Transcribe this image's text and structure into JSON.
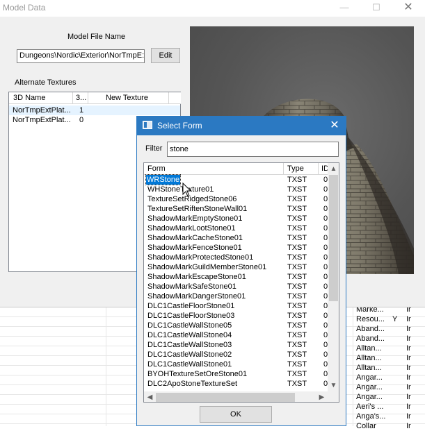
{
  "model_window": {
    "title": "Model Data",
    "model_file_label": "Model File Name",
    "model_file_value": "Dungeons\\Nordic\\Exterior\\NorTmpE:",
    "edit_label": "Edit",
    "alt_textures_label": "Alternate Textures",
    "table": {
      "headers": [
        "3D Name",
        "3...",
        "New Texture"
      ],
      "rows": [
        {
          "name": "NorTmpExtPlat...",
          "idx": "1"
        },
        {
          "name": "NorTmpExtPlat...",
          "idx": "0"
        }
      ]
    }
  },
  "background_list": {
    "rows": [
      {
        "a": "Marke...",
        "b": "",
        "c": "Ir"
      },
      {
        "a": "Resou...",
        "b": "Y",
        "c": "Ir"
      },
      {
        "a": "Aband...",
        "b": "",
        "c": "Ir"
      },
      {
        "a": "Aband...",
        "b": "",
        "c": "Ir"
      },
      {
        "a": "Alltan...",
        "b": "",
        "c": "Ir"
      },
      {
        "a": "Alltan...",
        "b": "",
        "c": "Ir"
      },
      {
        "a": "Alltan...",
        "b": "",
        "c": "Ir"
      },
      {
        "a": "Angar...",
        "b": "",
        "c": "Ir"
      },
      {
        "a": "Angar...",
        "b": "",
        "c": "Ir"
      },
      {
        "a": "Angar...",
        "b": "",
        "c": "Ir"
      },
      {
        "a": "Aeri's ...",
        "b": "",
        "c": "Ir"
      },
      {
        "a": "Anga's...",
        "b": "",
        "c": "Ir"
      },
      {
        "a": "Collar",
        "b": "",
        "c": "Ir"
      }
    ]
  },
  "select_form": {
    "title": "Select Form",
    "close_glyph": "✕",
    "filter_label": "Filter",
    "filter_value": "stone",
    "columns": [
      "Form",
      "Type",
      "ID"
    ],
    "rows": [
      {
        "form": "WRStone",
        "type": "TXST",
        "id": "0"
      },
      {
        "form": "WHStoneTexture01",
        "type": "TXST",
        "id": "0"
      },
      {
        "form": "TextureSetRidgedStone06",
        "type": "TXST",
        "id": "0"
      },
      {
        "form": "TextureSetRiftenStoneWall01",
        "type": "TXST",
        "id": "0"
      },
      {
        "form": "ShadowMarkEmptyStone01",
        "type": "TXST",
        "id": "0"
      },
      {
        "form": "ShadowMarkLootStone01",
        "type": "TXST",
        "id": "0"
      },
      {
        "form": "ShadowMarkCacheStone01",
        "type": "TXST",
        "id": "0"
      },
      {
        "form": "ShadowMarkFenceStone01",
        "type": "TXST",
        "id": "0"
      },
      {
        "form": "ShadowMarkProtectedStone01",
        "type": "TXST",
        "id": "0"
      },
      {
        "form": "ShadowMarkGuildMemberStone01",
        "type": "TXST",
        "id": "0"
      },
      {
        "form": "ShadowMarkEscapeStone01",
        "type": "TXST",
        "id": "0"
      },
      {
        "form": "ShadowMarkSafeStone01",
        "type": "TXST",
        "id": "0"
      },
      {
        "form": "ShadowMarkDangerStone01",
        "type": "TXST",
        "id": "0"
      },
      {
        "form": "DLC1CastleFloorStone01",
        "type": "TXST",
        "id": "0"
      },
      {
        "form": "DLC1CastleFloorStone03",
        "type": "TXST",
        "id": "0"
      },
      {
        "form": "DLC1CastleWallStone05",
        "type": "TXST",
        "id": "0"
      },
      {
        "form": "DLC1CastleWallStone04",
        "type": "TXST",
        "id": "0"
      },
      {
        "form": "DLC1CastleWallStone03",
        "type": "TXST",
        "id": "0"
      },
      {
        "form": "DLC1CastleWallStone02",
        "type": "TXST",
        "id": "0"
      },
      {
        "form": "DLC1CastleWallStone01",
        "type": "TXST",
        "id": "0"
      },
      {
        "form": "BYOHTextureSetOreStone01",
        "type": "TXST",
        "id": "0"
      },
      {
        "form": "DLC2ApoStoneTextureSet",
        "type": "TXST",
        "id": "0"
      }
    ],
    "selected_index": 0,
    "ok_label": "OK"
  },
  "colors": {
    "titlebar_active": "#2b79c2",
    "selection": "#0078d7"
  },
  "icons": [
    "minimize-icon",
    "maximize-icon",
    "close-icon",
    "window-icon",
    "chevron-up-icon",
    "chevron-down-icon",
    "chevron-left-icon",
    "chevron-right-icon",
    "mouse-pointer-icon"
  ]
}
